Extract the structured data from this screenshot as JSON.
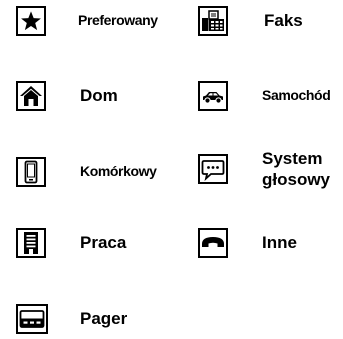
{
  "legend": {
    "items": [
      {
        "label": "Preferowany",
        "icon": "star-icon"
      },
      {
        "label": "Faks",
        "icon": "fax-icon"
      },
      {
        "label": "Dom",
        "icon": "home-icon"
      },
      {
        "label": "Samochód",
        "icon": "car-icon"
      },
      {
        "label": "Komórkowy",
        "icon": "mobile-phone-icon"
      },
      {
        "label": "System głosowy",
        "icon": "voice-system-icon"
      },
      {
        "label": "Praca",
        "icon": "work-icon"
      },
      {
        "label": "Inne",
        "icon": "other-phone-icon"
      },
      {
        "label": "Pager",
        "icon": "pager-icon"
      }
    ]
  }
}
